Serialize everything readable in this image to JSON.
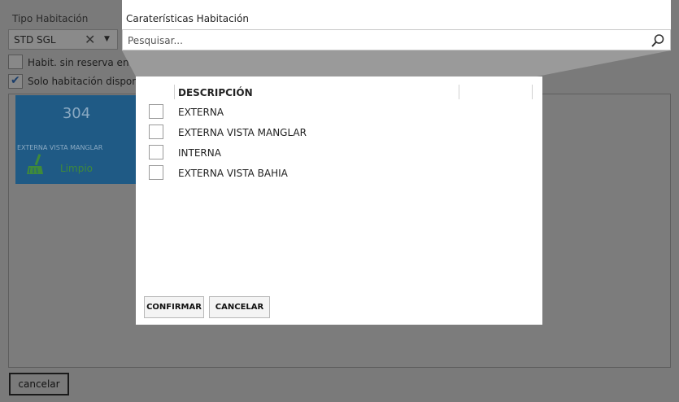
{
  "background_form": {
    "room_type_label": "Tipo Habitación",
    "room_type_value": "STD SGL",
    "checkbox_no_reservation_label": "Habit. sin reserva en la noche anterior",
    "checkbox_no_reservation_checked": false,
    "checkbox_available_label": "Solo habitación disponibl",
    "checkbox_available_checked": true,
    "room_card": {
      "number": "304",
      "description": "EXTERNA VISTA MANGLAR",
      "status": "Limpio",
      "color": "#1f5a85"
    },
    "cancel_label": "cancelar"
  },
  "popup": {
    "title": "Caraterísticas Habitación",
    "search_placeholder": "Pesquisar...",
    "column_header": "DESCRIPCIÓN",
    "rows": [
      {
        "label": "EXTERNA",
        "checked": false
      },
      {
        "label": "EXTERNA VISTA MANGLAR",
        "checked": false
      },
      {
        "label": "INTERNA",
        "checked": false
      },
      {
        "label": "EXTERNA VISTA BAHIA",
        "checked": false
      }
    ],
    "confirm_label": "CONFIRMAR",
    "cancel_label": "CANCELAR"
  }
}
